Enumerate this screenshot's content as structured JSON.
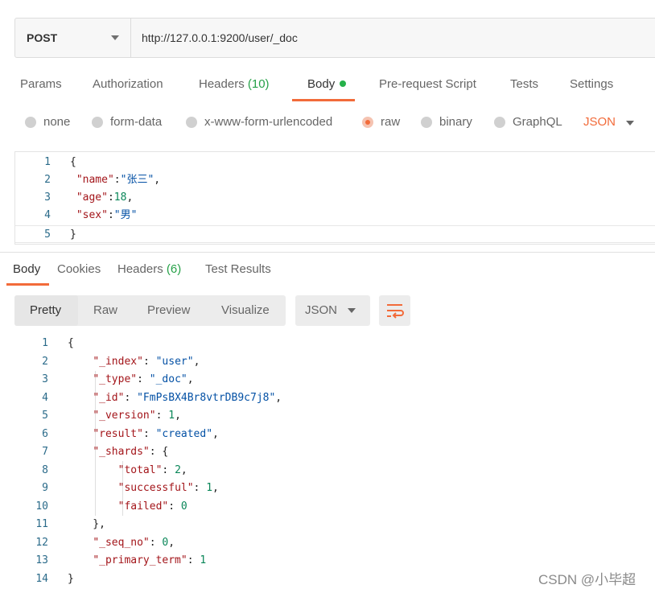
{
  "request": {
    "method": "POST",
    "url": "http://127.0.0.1:9200/user/_doc"
  },
  "request_tabs": [
    {
      "label": "Params"
    },
    {
      "label": "Authorization"
    },
    {
      "label": "Headers",
      "count": "(10)"
    },
    {
      "label": "Body",
      "active": true
    },
    {
      "label": "Pre-request Script"
    },
    {
      "label": "Tests"
    },
    {
      "label": "Settings"
    }
  ],
  "body_types": [
    {
      "label": "none"
    },
    {
      "label": "form-data"
    },
    {
      "label": "x-www-form-urlencoded"
    },
    {
      "label": "raw",
      "selected": true
    },
    {
      "label": "binary"
    },
    {
      "label": "GraphQL"
    }
  ],
  "raw_format": "JSON",
  "request_body_lines": [
    {
      "num": "1",
      "text": "{"
    },
    {
      "num": "2",
      "text": " \"name\":\"张三\","
    },
    {
      "num": "3",
      "text": " \"age\":18,"
    },
    {
      "num": "4",
      "text": " \"sex\":\"男\""
    },
    {
      "num": "5",
      "text": "}"
    }
  ],
  "response_tabs": [
    {
      "label": "Body",
      "active": true
    },
    {
      "label": "Cookies"
    },
    {
      "label": "Headers",
      "count": "(6)"
    },
    {
      "label": "Test Results"
    }
  ],
  "view_modes": [
    "Pretty",
    "Raw",
    "Preview",
    "Visualize"
  ],
  "response_format": "JSON",
  "response_lines": [
    {
      "num": "1",
      "text": "{"
    },
    {
      "num": "2",
      "text": "    \"_index\": \"user\","
    },
    {
      "num": "3",
      "text": "    \"_type\": \"_doc\","
    },
    {
      "num": "4",
      "text": "    \"_id\": \"FmPsBX4Br8vtrDB9c7j8\","
    },
    {
      "num": "5",
      "text": "    \"_version\": 1,"
    },
    {
      "num": "6",
      "text": "    \"result\": \"created\","
    },
    {
      "num": "7",
      "text": "    \"_shards\": {"
    },
    {
      "num": "8",
      "text": "        \"total\": 2,"
    },
    {
      "num": "9",
      "text": "        \"successful\": 1,"
    },
    {
      "num": "10",
      "text": "        \"failed\": 0"
    },
    {
      "num": "11",
      "text": "    },"
    },
    {
      "num": "12",
      "text": "    \"_seq_no\": 0,"
    },
    {
      "num": "13",
      "text": "    \"_primary_term\": 1"
    },
    {
      "num": "14",
      "text": "}"
    }
  ],
  "watermark": "CSDN @小毕超",
  "colors": {
    "accent": "#f26b3a",
    "count": "#26a148",
    "key": "#a3151a",
    "string": "#0451a5",
    "number": "#098658"
  },
  "icons": [
    "chevron-down-icon",
    "radio-icon",
    "wrap-lines-icon",
    "active-dot-icon"
  ]
}
